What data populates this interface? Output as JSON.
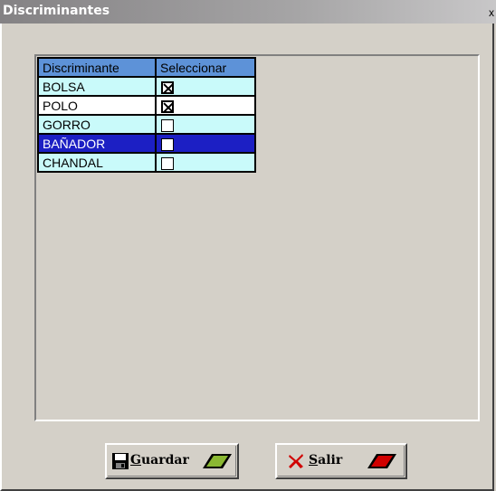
{
  "window": {
    "title": "Discriminantes",
    "close_glyph": "x"
  },
  "grid": {
    "headers": [
      "Discriminante",
      "Seleccionar"
    ],
    "rows": [
      {
        "name": "BOLSA",
        "checked": true,
        "state": "alt"
      },
      {
        "name": "POLO",
        "checked": true,
        "state": "white"
      },
      {
        "name": "GORRO",
        "checked": false,
        "state": "alt"
      },
      {
        "name": "BAÑADOR",
        "checked": false,
        "state": "selected"
      },
      {
        "name": "CHANDAL",
        "checked": false,
        "state": "alt"
      }
    ]
  },
  "buttons": {
    "guardar": {
      "accel": "G",
      "rest": "uardar",
      "icon": "floppy-disk-icon"
    },
    "salir": {
      "accel": "S",
      "rest": "alir",
      "icon": "red-x-icon"
    }
  },
  "colors": {
    "header_bg": "#5d92d8",
    "row_alt_bg": "#c9fafa",
    "row_selected_bg": "#1c1fc4",
    "window_bg": "#d4d0c8"
  }
}
